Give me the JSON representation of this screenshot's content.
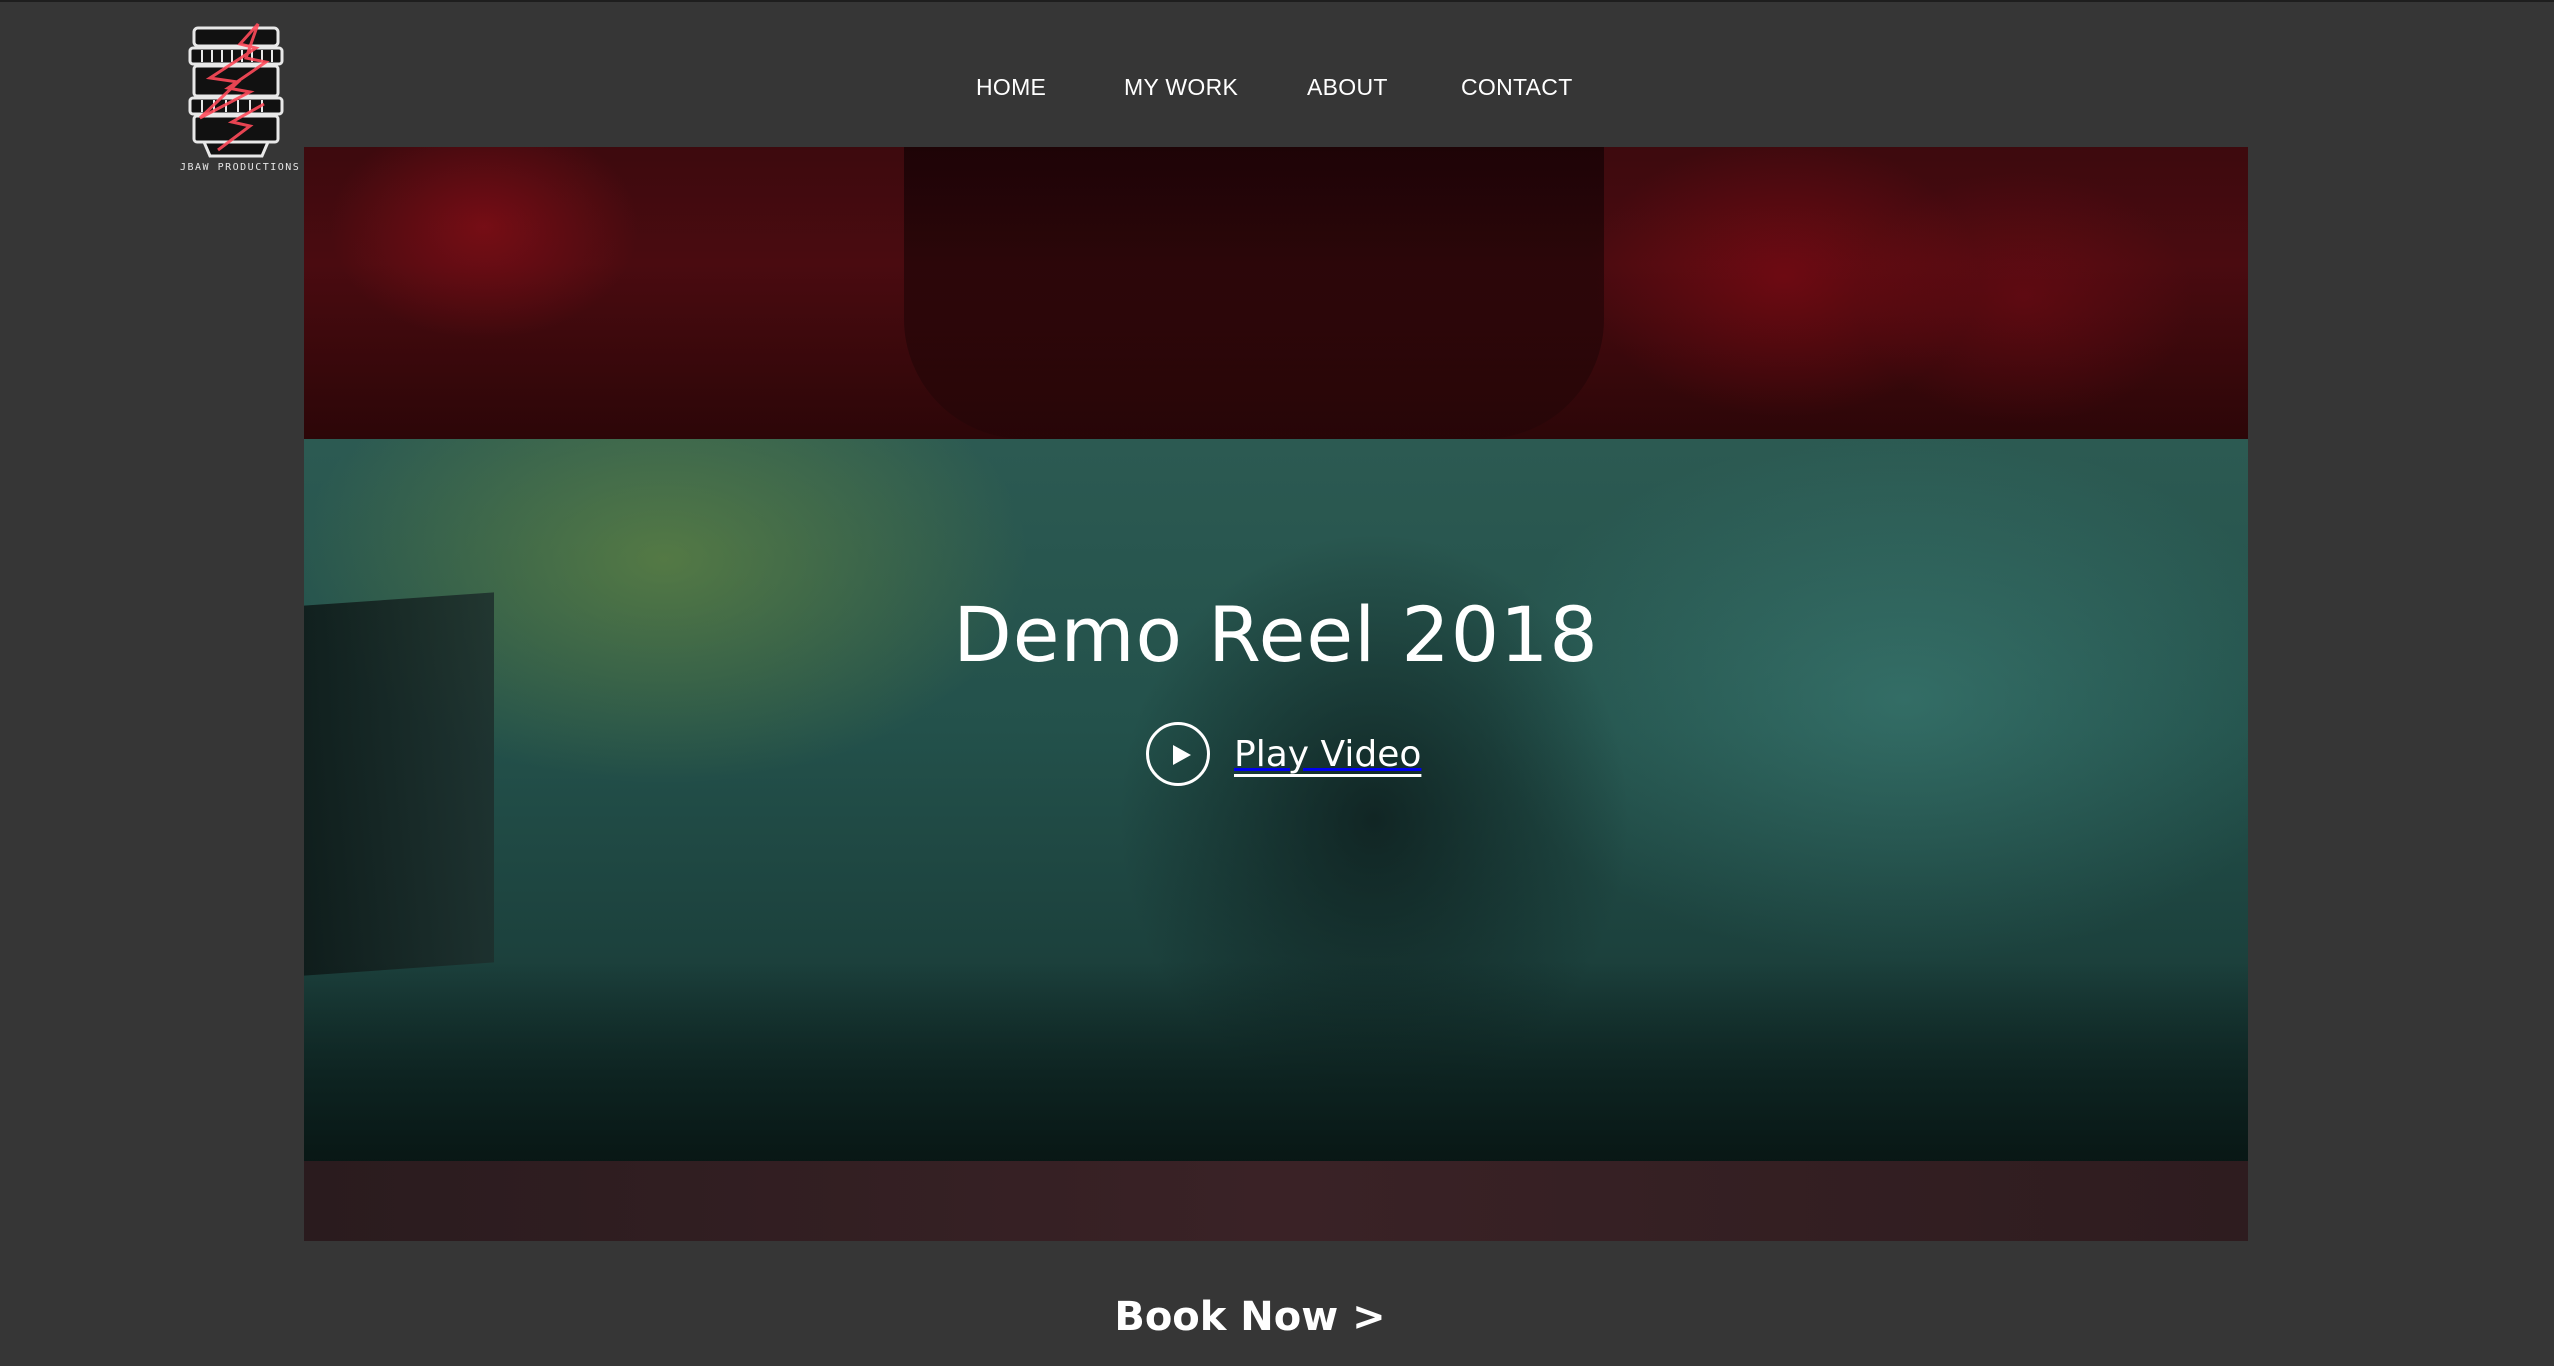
{
  "brand": {
    "logo_text": "JBAW PRODUCTIONS",
    "logo_icon": "lens-lightning-icon",
    "accent": "#e0273a"
  },
  "nav": {
    "items": [
      {
        "label": "HOME"
      },
      {
        "label": "MY WORK"
      },
      {
        "label": "ABOUT"
      },
      {
        "label": "CONTACT"
      }
    ]
  },
  "hero": {
    "title": "Demo Reel 2018",
    "play_label": "Play Video",
    "play_icon": "play-icon"
  },
  "cta": {
    "book_label": "Book Now >"
  },
  "colors": {
    "background": "#363636",
    "text": "#ffffff",
    "hero_red": "#4a0b10",
    "hero_teal": "#23514b"
  }
}
